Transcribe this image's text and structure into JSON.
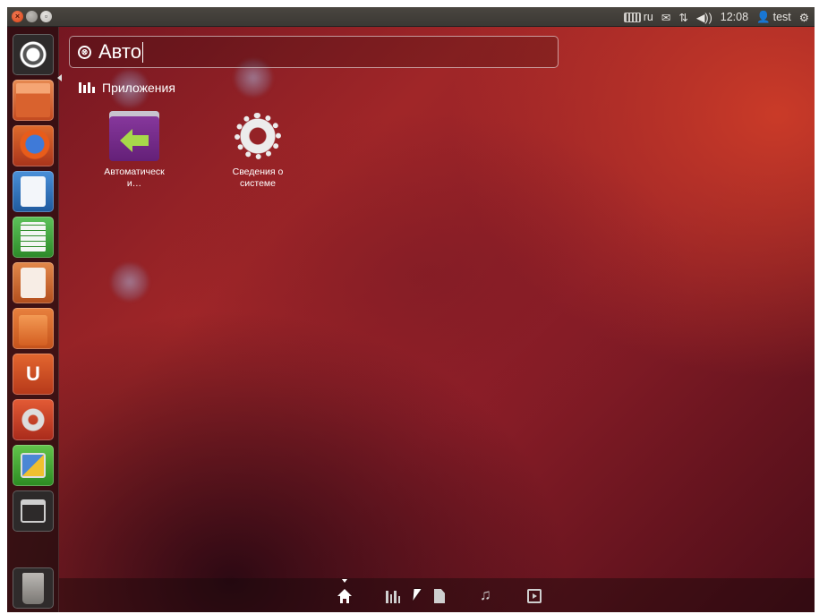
{
  "top_panel": {
    "window_buttons": [
      "close",
      "minimize",
      "maximize"
    ],
    "keyboard_layout": "ru",
    "time": "12:08",
    "user": "test",
    "icons": [
      "keyboard-icon",
      "mail-icon",
      "network-icon",
      "volume-icon",
      "user-icon",
      "gear-icon"
    ]
  },
  "launcher": {
    "items": [
      {
        "name": "dash",
        "icon": "ubuntu-logo-icon"
      },
      {
        "name": "files",
        "icon": "folder-icon"
      },
      {
        "name": "firefox",
        "icon": "firefox-icon"
      },
      {
        "name": "writer",
        "icon": "writer-icon"
      },
      {
        "name": "calc",
        "icon": "calc-icon"
      },
      {
        "name": "impress",
        "icon": "impress-icon"
      },
      {
        "name": "software-center",
        "icon": "shopping-bag-icon"
      },
      {
        "name": "ubuntu-one",
        "icon": "ubuntu-one-icon",
        "glyph": "U"
      },
      {
        "name": "system-settings",
        "icon": "settings-icon"
      },
      {
        "name": "workspaces",
        "icon": "workspaces-icon"
      },
      {
        "name": "window-switcher",
        "icon": "window-icon"
      },
      {
        "name": "trash",
        "icon": "trash-icon"
      }
    ]
  },
  "dash": {
    "search": {
      "clear_glyph": "⊗",
      "query": "Авто"
    },
    "category": "Приложения",
    "results": [
      {
        "line1": "Автоматическ",
        "line2": "и…",
        "icon": "startup-apps-icon"
      },
      {
        "line1": "Сведения о",
        "line2": "системе",
        "icon": "system-info-gear-icon"
      }
    ]
  },
  "lens_bar": {
    "lenses": [
      "home-icon",
      "applications-icon",
      "files-icon",
      "music-icon",
      "video-icon"
    ],
    "music_glyph": "♫",
    "active": "home"
  },
  "colors": {
    "background_accent": "#a02628",
    "launcher_bg": "#1e0c0e",
    "panel_bg": "#3b3834"
  }
}
